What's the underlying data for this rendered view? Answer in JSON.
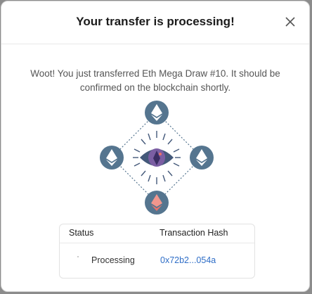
{
  "modal": {
    "title": "Your transfer is processing!",
    "close_icon": "close-icon",
    "message": "Woot! You just transferred Eth Mega Draw #10. It should be confirmed on the blockchain shortly."
  },
  "illustration": {
    "icons": [
      "ethereum-icon",
      "ethereum-icon",
      "ethereum-icon",
      "ethereum-icon",
      "eye-icon"
    ],
    "colors": {
      "node": "#55758f",
      "eye_dark": "#44597a",
      "eye_iris": "#7b5ea3",
      "accent": "#e8726b"
    }
  },
  "status_table": {
    "status_header": "Status",
    "hash_header": "Transaction Hash",
    "status_value": "Processing",
    "hash_value": "0x72b2...054a"
  },
  "colors": {
    "link": "#2f6ec7"
  }
}
